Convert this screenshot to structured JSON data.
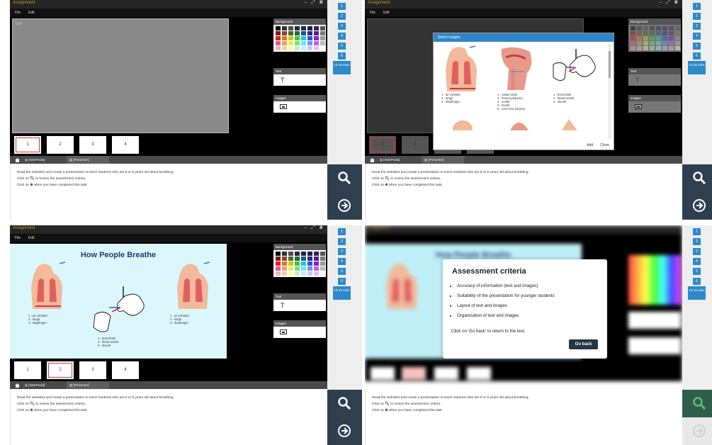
{
  "app": {
    "title": "Assignment",
    "menu": [
      "File",
      "Edit"
    ],
    "canvas_label": "Slide",
    "window_controls": "– ⤢ ✖"
  },
  "panels": {
    "background": "Background",
    "text": "Text",
    "images": "Images",
    "text_icon": "T"
  },
  "palette": [
    "#000000",
    "#333333",
    "#4d4d4d",
    "#2b2b2b",
    "#1a2c4d",
    "#1f1f5e",
    "#3a1e5c",
    "#555555",
    "#7a1f1f",
    "#8a4a1f",
    "#4a6a1f",
    "#1f6a4a",
    "#1f5a7a",
    "#1f2f8a",
    "#5a1f7a",
    "#777777",
    "#e01f1f",
    "#e07a1f",
    "#c8c81f",
    "#3ac83a",
    "#1fc8c8",
    "#1f5ae0",
    "#8a1fe0",
    "#999999",
    "#e05a9a",
    "#f0a05a",
    "#e8e86a",
    "#7ae07a",
    "#6ae8e8",
    "#6a9ae8",
    "#b06ae8",
    "#bbbbbb",
    "#f0b0c0",
    "#f8d0a0",
    "#f8f8b0",
    "#c0f0c0",
    "#c0f0f0",
    "#c0d0f8",
    "#e0c0f8",
    "#ffffff"
  ],
  "pages": [
    "1",
    "2",
    "3",
    "4"
  ],
  "tabs": [
    "[WebPedia]",
    "[Presenter]"
  ],
  "task": {
    "line1": "Read the websites and create a presentation to teach students who are 8 or 9 years old about breathing.",
    "line2_pre": "Click on",
    "line2_post": "to review the assessment criteria.",
    "line3_pre": "Click on",
    "line3_post": "when you have completed this task."
  },
  "sidebar": {
    "numbers": [
      "1",
      "2",
      "3",
      "4",
      "5",
      "6"
    ],
    "time": "13-15 mins"
  },
  "dialog": {
    "title": "Select images",
    "add": "Add",
    "close": "Close",
    "captions": [
      "1 - air exhaled\n2 - lungs\n3 - diaphragm",
      "1 - nasal cavity\n2 - throat (pharynx)\n3 - nostril\n4 - mouth\n5 - voice box (larynx)",
      "1 - bronchiole\n2 - blood vessel\n3 - alveoli"
    ]
  },
  "slide": {
    "title": "How People Breathe",
    "cap_left": "1 - air exhaled\n2 - lungs\n3 - diaphragm",
    "cap_mid": "1 - bronchiole\n2 - blood vessel\n3 - alveoli",
    "cap_right": "1 - air exhaled\n2 - lungs\n3 - diaphragm"
  },
  "criteria": {
    "title": "Assessment criteria",
    "items": [
      "Accuracy of information (text and images)",
      "Suitability of the presentation for younger students",
      "Layout of text and images",
      "Organization of text and images"
    ],
    "footer": "Click on 'Go back' to return to the test.",
    "go_back": "Go back"
  }
}
